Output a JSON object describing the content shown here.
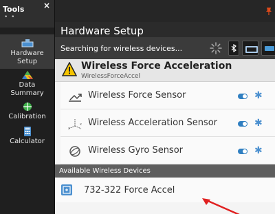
{
  "tools_panel": {
    "title": "Tools",
    "close_symbol": "×",
    "dots": "• •",
    "items": [
      {
        "label_line1": "Hardware",
        "label_line2": "Setup",
        "icon": "hardware-setup-icon"
      },
      {
        "label_line1": "Data",
        "label_line2": "Summary",
        "icon": "data-summary-icon"
      },
      {
        "label_line1": "Calibration",
        "label_line2": "",
        "icon": "calibration-icon"
      },
      {
        "label_line1": "Calculator",
        "label_line2": "",
        "icon": "calculator-icon"
      }
    ]
  },
  "main": {
    "pin_symbol": "📌",
    "title": "Hardware Setup",
    "search_status": "Searching for wireless devices...",
    "bluetooth_symbol": "✱"
  },
  "device": {
    "name": "Wireless Force Acceleration",
    "subtitle": "WirelessForceAccel"
  },
  "sensors": [
    {
      "label": "Wireless Force Sensor",
      "icon": "force-sensor-icon"
    },
    {
      "label": "Wireless Acceleration Sensor",
      "icon": "acceleration-sensor-icon"
    },
    {
      "label": "Wireless Gyro Sensor",
      "icon": "gyro-sensor-icon"
    }
  ],
  "gear_symbol": "✱",
  "available": {
    "header": "Available Wireless Devices",
    "items": [
      {
        "label": "732-322  Force Accel",
        "icon": "wireless-device-icon"
      }
    ]
  },
  "colors": {
    "accent": "#2f7fc1",
    "pin": "#e04a1a",
    "arrow": "#e02020"
  }
}
